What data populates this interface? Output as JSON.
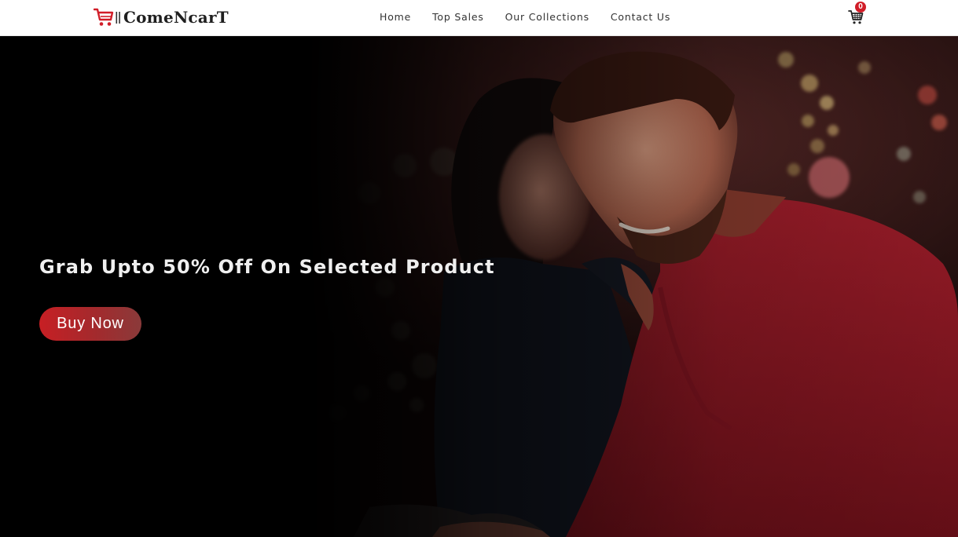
{
  "brand": {
    "name": "ComeNcarT",
    "icon": "cart-logo-icon",
    "accent_color": "#d11d28"
  },
  "nav": {
    "items": [
      {
        "label": "Home"
      },
      {
        "label": "Top Sales"
      },
      {
        "label": "Our Collections"
      },
      {
        "label": "Contact Us"
      }
    ]
  },
  "cart": {
    "icon": "shopping-cart-icon",
    "count": "0"
  },
  "hero": {
    "headline": "Grab Upto 50% Off On Selected Product",
    "cta_label": "Buy Now",
    "image": "couple-laughing-photo",
    "button_color": "#c71f24"
  }
}
